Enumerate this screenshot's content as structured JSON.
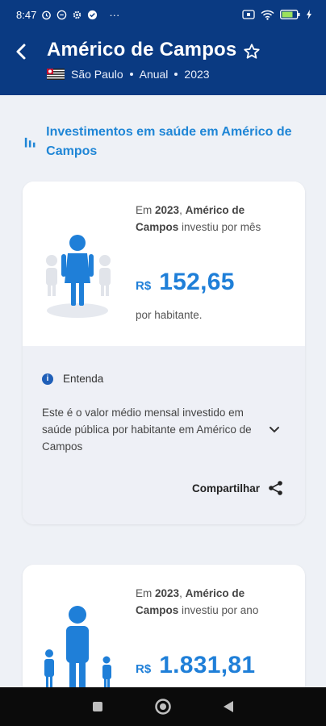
{
  "status_bar": {
    "time": "8:47",
    "more": "···",
    "battery": ""
  },
  "header": {
    "title": "Américo de Campos",
    "state": "São Paulo",
    "period": "Anual",
    "year": "2023"
  },
  "section": {
    "title": "Investimentos em saúde em Américo de Campos"
  },
  "card1": {
    "desc_prefix": "Em ",
    "desc_year": "2023",
    "desc_sep": ", ",
    "desc_city": "Américo de Campos",
    "desc_suffix": " investiu por mês",
    "currency": "R$",
    "value": "152,65",
    "per": "por habitante.",
    "entenda": "Entenda",
    "explanation": "Este é o valor médio mensal investido em saúde pública por habitante em Américo de Campos",
    "share": "Compartilhar"
  },
  "card2": {
    "desc_prefix": "Em ",
    "desc_year": "2023",
    "desc_sep": ", ",
    "desc_city": "Américo de Campos",
    "desc_suffix": " investiu por ano",
    "currency": "R$",
    "value": "1.831,81"
  },
  "colors": {
    "header": "#0a3a82",
    "accent": "#1f7fd8",
    "background": "#eef1f6"
  }
}
